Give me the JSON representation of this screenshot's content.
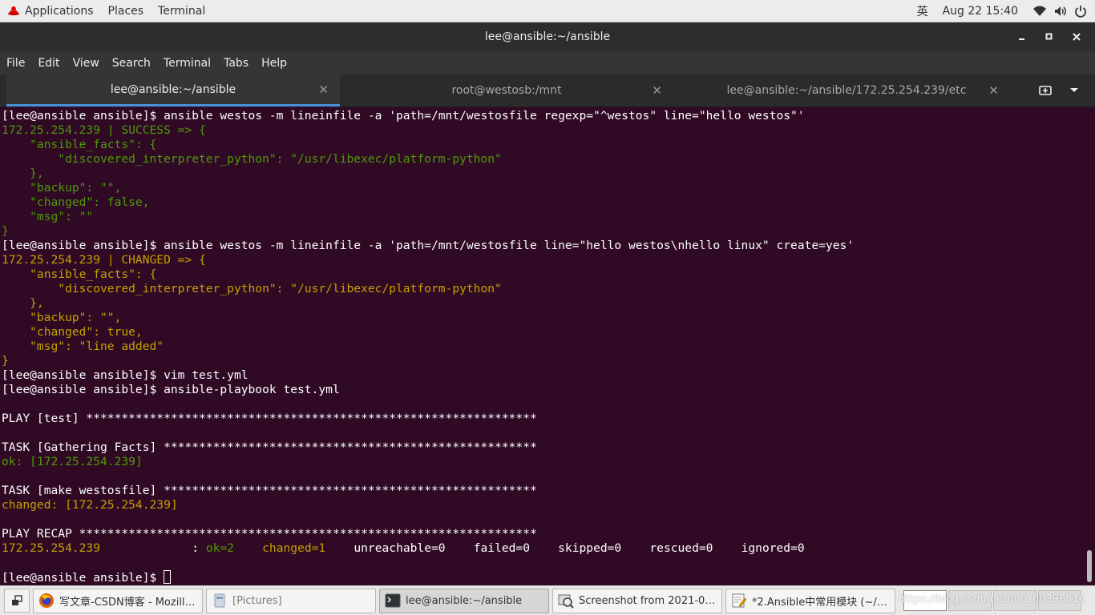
{
  "topbar": {
    "applications": "Applications",
    "places": "Places",
    "terminal": "Terminal",
    "input_method": "英",
    "clock": "Aug 22  15:40",
    "icons": [
      "redhat-icon",
      "wifi-icon",
      "volume-icon",
      "power-icon"
    ]
  },
  "window": {
    "title": "lee@ansible:~/ansible",
    "buttons": [
      "minimize",
      "maximize",
      "close"
    ]
  },
  "menubar": {
    "items": [
      "File",
      "Edit",
      "View",
      "Search",
      "Terminal",
      "Tabs",
      "Help"
    ]
  },
  "tabs": [
    {
      "label": "lee@ansible:~/ansible",
      "active": true
    },
    {
      "label": "root@westosb:/mnt",
      "active": false
    },
    {
      "label": "lee@ansible:~/ansible/172.25.254.239/etc",
      "active": false
    }
  ],
  "terminal": {
    "colors": {
      "background": "#300a24",
      "green": "#4e9a06",
      "yellow": "#c4a000",
      "white": "#ffffff"
    },
    "lines": [
      [
        {
          "t": "[lee@ansible ansible]$ ansible westos -m lineinfile -a 'path=/mnt/westosfile regexp=\"^westos\" line=\"hello westos\"'",
          "c": "white"
        }
      ],
      [
        {
          "t": "172.25.254.239 | SUCCESS => {",
          "c": "green"
        }
      ],
      [
        {
          "t": "    \"ansible_facts\": {",
          "c": "green"
        }
      ],
      [
        {
          "t": "        \"discovered_interpreter_python\": \"/usr/libexec/platform-python\"",
          "c": "green"
        }
      ],
      [
        {
          "t": "    },",
          "c": "green"
        }
      ],
      [
        {
          "t": "    \"backup\": \"\",",
          "c": "green"
        }
      ],
      [
        {
          "t": "    \"changed\": false,",
          "c": "green"
        }
      ],
      [
        {
          "t": "    \"msg\": \"\"",
          "c": "green"
        }
      ],
      [
        {
          "t": "}",
          "c": "green"
        }
      ],
      [
        {
          "t": "[lee@ansible ansible]$ ansible westos -m lineinfile -a 'path=/mnt/westosfile line=\"hello westos\\nhello linux\" create=yes'",
          "c": "white"
        }
      ],
      [
        {
          "t": "172.25.254.239 | CHANGED => {",
          "c": "yellow"
        }
      ],
      [
        {
          "t": "    \"ansible_facts\": {",
          "c": "yellow"
        }
      ],
      [
        {
          "t": "        \"discovered_interpreter_python\": \"/usr/libexec/platform-python\"",
          "c": "yellow"
        }
      ],
      [
        {
          "t": "    },",
          "c": "yellow"
        }
      ],
      [
        {
          "t": "    \"backup\": \"\",",
          "c": "yellow"
        }
      ],
      [
        {
          "t": "    \"changed\": true,",
          "c": "yellow"
        }
      ],
      [
        {
          "t": "    \"msg\": \"line added\"",
          "c": "yellow"
        }
      ],
      [
        {
          "t": "}",
          "c": "yellow"
        }
      ],
      [
        {
          "t": "[lee@ansible ansible]$ vim test.yml",
          "c": "white"
        }
      ],
      [
        {
          "t": "[lee@ansible ansible]$ ansible-playbook test.yml",
          "c": "white"
        }
      ],
      [
        {
          "t": "",
          "c": "white"
        }
      ],
      [
        {
          "t": "PLAY [test] ****************************************************************",
          "c": "white"
        }
      ],
      [
        {
          "t": "",
          "c": "white"
        }
      ],
      [
        {
          "t": "TASK [Gathering Facts] *****************************************************",
          "c": "white"
        }
      ],
      [
        {
          "t": "ok: [172.25.254.239]",
          "c": "green"
        }
      ],
      [
        {
          "t": "",
          "c": "white"
        }
      ],
      [
        {
          "t": "TASK [make westosfile] *****************************************************",
          "c": "white"
        }
      ],
      [
        {
          "t": "changed: [172.25.254.239]",
          "c": "yellow"
        }
      ],
      [
        {
          "t": "",
          "c": "white"
        }
      ],
      [
        {
          "t": "PLAY RECAP *****************************************************************",
          "c": "white"
        }
      ],
      [
        {
          "t": "172.25.254.239",
          "c": "yellow"
        },
        {
          "t": "             : ",
          "c": "white"
        },
        {
          "t": "ok=2",
          "c": "green"
        },
        {
          "t": "    ",
          "c": "white"
        },
        {
          "t": "changed=1",
          "c": "yellow"
        },
        {
          "t": "    unreachable=0    failed=0    skipped=0    rescued=0    ignored=0",
          "c": "white"
        }
      ],
      [
        {
          "t": "",
          "c": "white"
        }
      ],
      [
        {
          "t": "[lee@ansible ansible]$ ",
          "c": "white",
          "cursor": true
        }
      ]
    ]
  },
  "taskbar": {
    "tasks": [
      {
        "label": "写文章-CSDN博客 - Mozilla...",
        "icon": "firefox-icon",
        "active": false,
        "dim": false
      },
      {
        "label": "[Pictures]",
        "icon": "file-manager-icon",
        "active": false,
        "dim": true
      },
      {
        "label": "lee@ansible:~/ansible",
        "icon": "terminal-icon",
        "active": true,
        "dim": false
      },
      {
        "label": "Screenshot from 2021-08...",
        "icon": "image-viewer-icon",
        "active": false,
        "dim": false
      },
      {
        "label": "*2.Ansible中常用模块 (~/D...",
        "icon": "text-editor-icon",
        "active": false,
        "dim": false
      }
    ],
    "watermark": "https://blog.csdn.net/m0_60396816"
  }
}
